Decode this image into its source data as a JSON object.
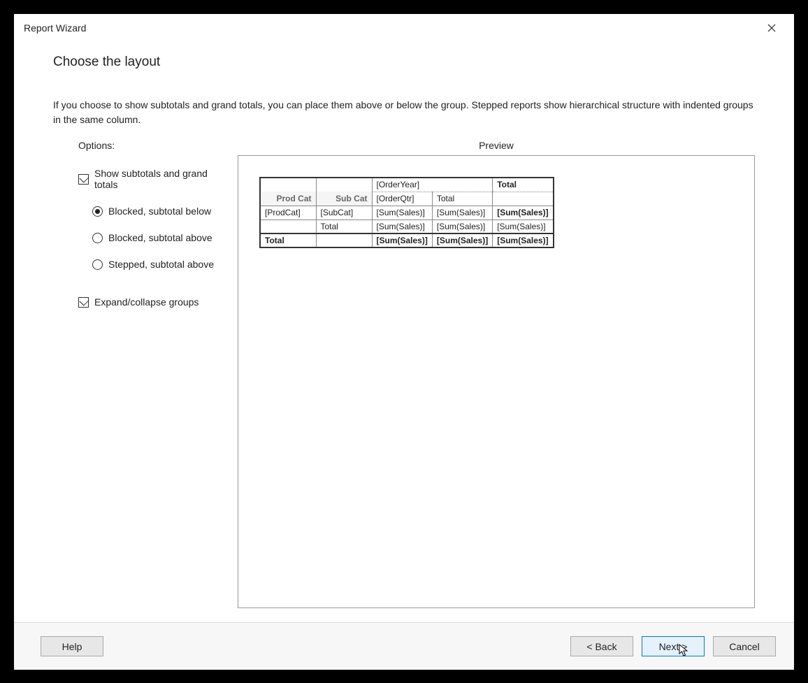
{
  "dialog": {
    "title": "Report Wizard"
  },
  "page": {
    "heading": "Choose the layout",
    "description": "If you choose to show subtotals and grand totals, you can place them above or below the group. Stepped reports show hierarchical structure with indented groups in the same column."
  },
  "options": {
    "label": "Options:",
    "show_subtotals_label": "Show subtotals and grand totals",
    "show_subtotals_checked": true,
    "layout_choices": {
      "blocked_below": "Blocked, subtotal below",
      "blocked_above": "Blocked, subtotal above",
      "stepped_above": "Stepped, subtotal above",
      "selected": "blocked_below"
    },
    "expand_collapse_label": "Expand/collapse groups",
    "expand_collapse_checked": true
  },
  "preview": {
    "label": "Preview",
    "table": {
      "row1": {
        "c3": "[OrderYear]",
        "c5": "Total"
      },
      "row2": {
        "c1": "Prod Cat",
        "c2": "Sub Cat",
        "c3": "[OrderQtr]",
        "c4": "Total"
      },
      "row3": {
        "c1": "[ProdCat]",
        "c2": "[SubCat]",
        "c3": "[Sum(Sales)]",
        "c4": "[Sum(Sales)]",
        "c5": "[Sum(Sales)]"
      },
      "row4": {
        "c2": "Total",
        "c3": "[Sum(Sales)]",
        "c4": "[Sum(Sales)]",
        "c5": "[Sum(Sales)]"
      },
      "row5": {
        "c1": "Total",
        "c3": "[Sum(Sales)]",
        "c4": "[Sum(Sales)]",
        "c5": "[Sum(Sales)]"
      }
    }
  },
  "buttons": {
    "help": "Help",
    "back": "< Back",
    "next": "Next >",
    "cancel": "Cancel"
  }
}
